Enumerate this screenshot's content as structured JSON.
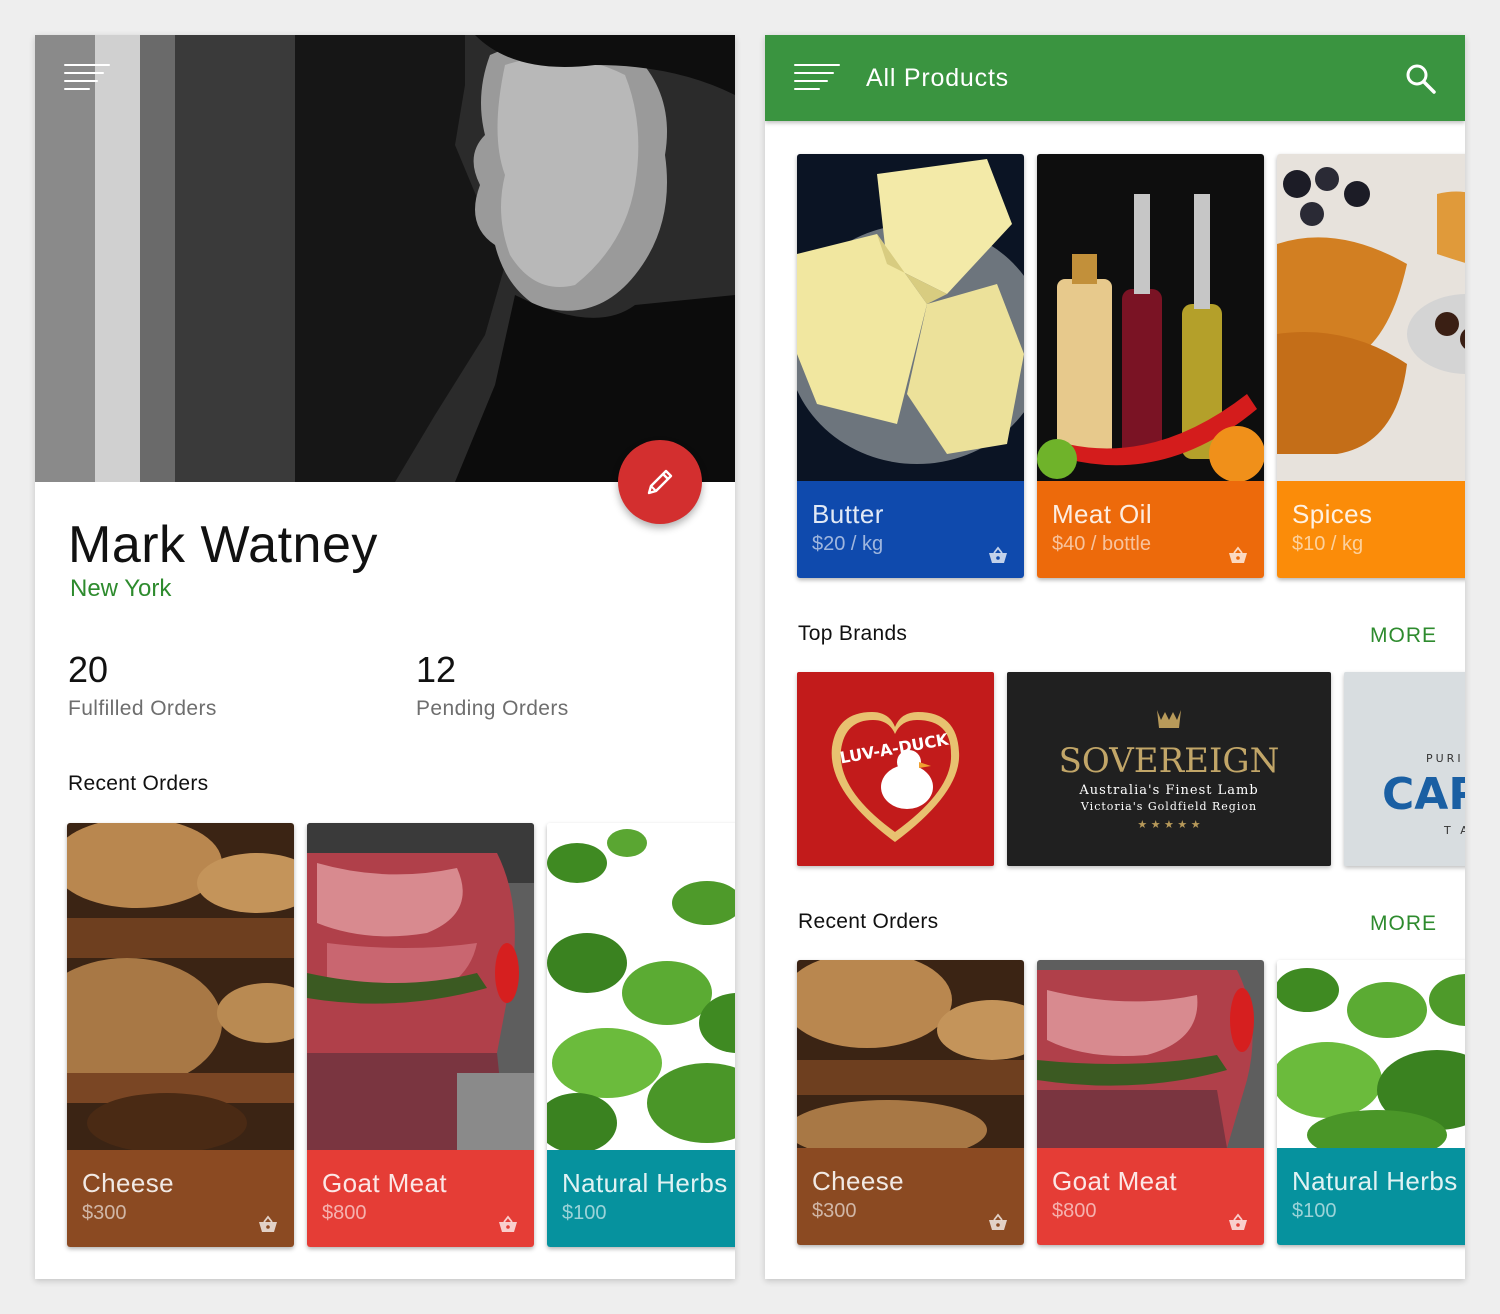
{
  "profile": {
    "name": "Mark Watney",
    "city": "New York",
    "stats": [
      {
        "value": "20",
        "label": "Fulfilled Orders"
      },
      {
        "value": "12",
        "label": "Pending Orders"
      }
    ],
    "recent_orders_title": "Recent Orders",
    "recent_orders": [
      {
        "name": "Cheese",
        "price": "$300",
        "color": "#8b4a22"
      },
      {
        "name": "Goat Meat",
        "price": "$800",
        "color": "#e53d36"
      },
      {
        "name": "Natural Herbs",
        "price": "$100",
        "color": "#06929e"
      }
    ]
  },
  "store": {
    "title": "All Products",
    "products": [
      {
        "name": "Butter",
        "price": "$20 / kg",
        "color": "#0f4aad"
      },
      {
        "name": "Meat Oil",
        "price": "$40 / bottle",
        "color": "#ed6a0b"
      },
      {
        "name": "Spices",
        "price": "$10 / kg",
        "color": "#fb8c09"
      }
    ],
    "top_brands_title": "Top Brands",
    "more_label": "MORE",
    "brands": {
      "luv_a_duck": "LUV-A-DUCK",
      "sovereign_name": "SOVEREIGN",
      "sovereign_tagline": "Australia's Finest Lamb",
      "sovereign_region": "Victoria's Goldfield Region",
      "sovereign_stars": "★ ★ ★ ★ ★",
      "cap_top": "PURI",
      "cap_name": "CAP",
      "cap_bottom": "T A"
    },
    "recent_orders_title": "Recent Orders",
    "recent_orders": [
      {
        "name": "Cheese",
        "price": "$300",
        "color": "#8b4a22"
      },
      {
        "name": "Goat Meat",
        "price": "$800",
        "color": "#e53d36"
      },
      {
        "name": "Natural Herbs",
        "price": "$100",
        "color": "#06929e"
      }
    ]
  },
  "icons": {
    "menu": "menu-sort-icon",
    "edit": "pencil-icon",
    "search": "search-icon",
    "basket": "basket-icon"
  }
}
